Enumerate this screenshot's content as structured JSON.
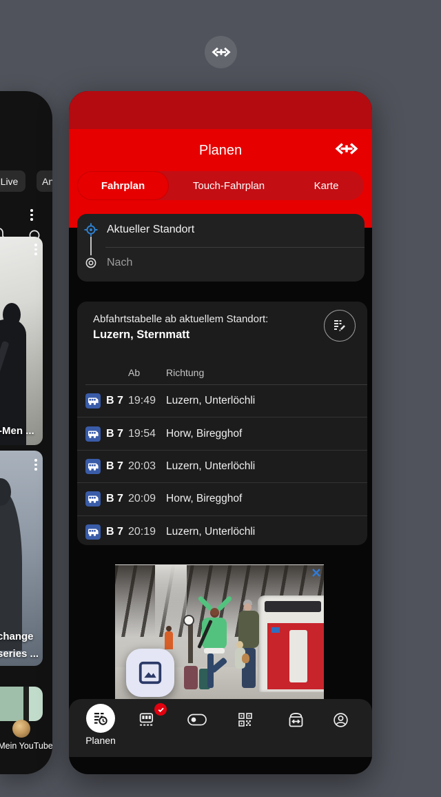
{
  "colors": {
    "background": "#50535B",
    "sbb_red": "#E60000",
    "sbb_red_dark": "#B30B10",
    "sbb_red_track": "#C30E14",
    "bus_blue": "#3A5CA8",
    "location_blue": "#2D7FD0",
    "badge_red": "#E3000F",
    "ad_close_blue": "#2F7BD9"
  },
  "switcher": {
    "app_logo_icon": "sbb-double-arrow"
  },
  "youtube": {
    "chips": [
      "Live",
      "An"
    ],
    "video1_title": "-Men ...",
    "video2_title_line1": "change",
    "video2_title_line2": "series ...",
    "profile_label": "Mein YouTube"
  },
  "sbb": {
    "title": "Planen",
    "tabs": [
      "Fahrplan",
      "Touch-Fahrplan",
      "Karte"
    ],
    "from_value": "Aktueller Standort",
    "to_placeholder": "Nach",
    "departures_title": "Abfahrtstabelle ab aktuellem Standort:",
    "departures_station": "Luzern, Sternmatt",
    "col_ab": "Ab",
    "col_richtung": "Richtung",
    "rows": [
      {
        "line": "B 7",
        "time": "19:49",
        "direction": "Luzern, Unterlöchli"
      },
      {
        "line": "B 7",
        "time": "19:54",
        "direction": "Horw, Biregghof"
      },
      {
        "line": "B 7",
        "time": "20:03",
        "direction": "Luzern, Unterlöchli"
      },
      {
        "line": "B 7",
        "time": "20:09",
        "direction": "Horw, Biregghof"
      },
      {
        "line": "B 7",
        "time": "20:19",
        "direction": "Luzern, Unterlöchli"
      }
    ],
    "nav_active_label": "Planen"
  }
}
